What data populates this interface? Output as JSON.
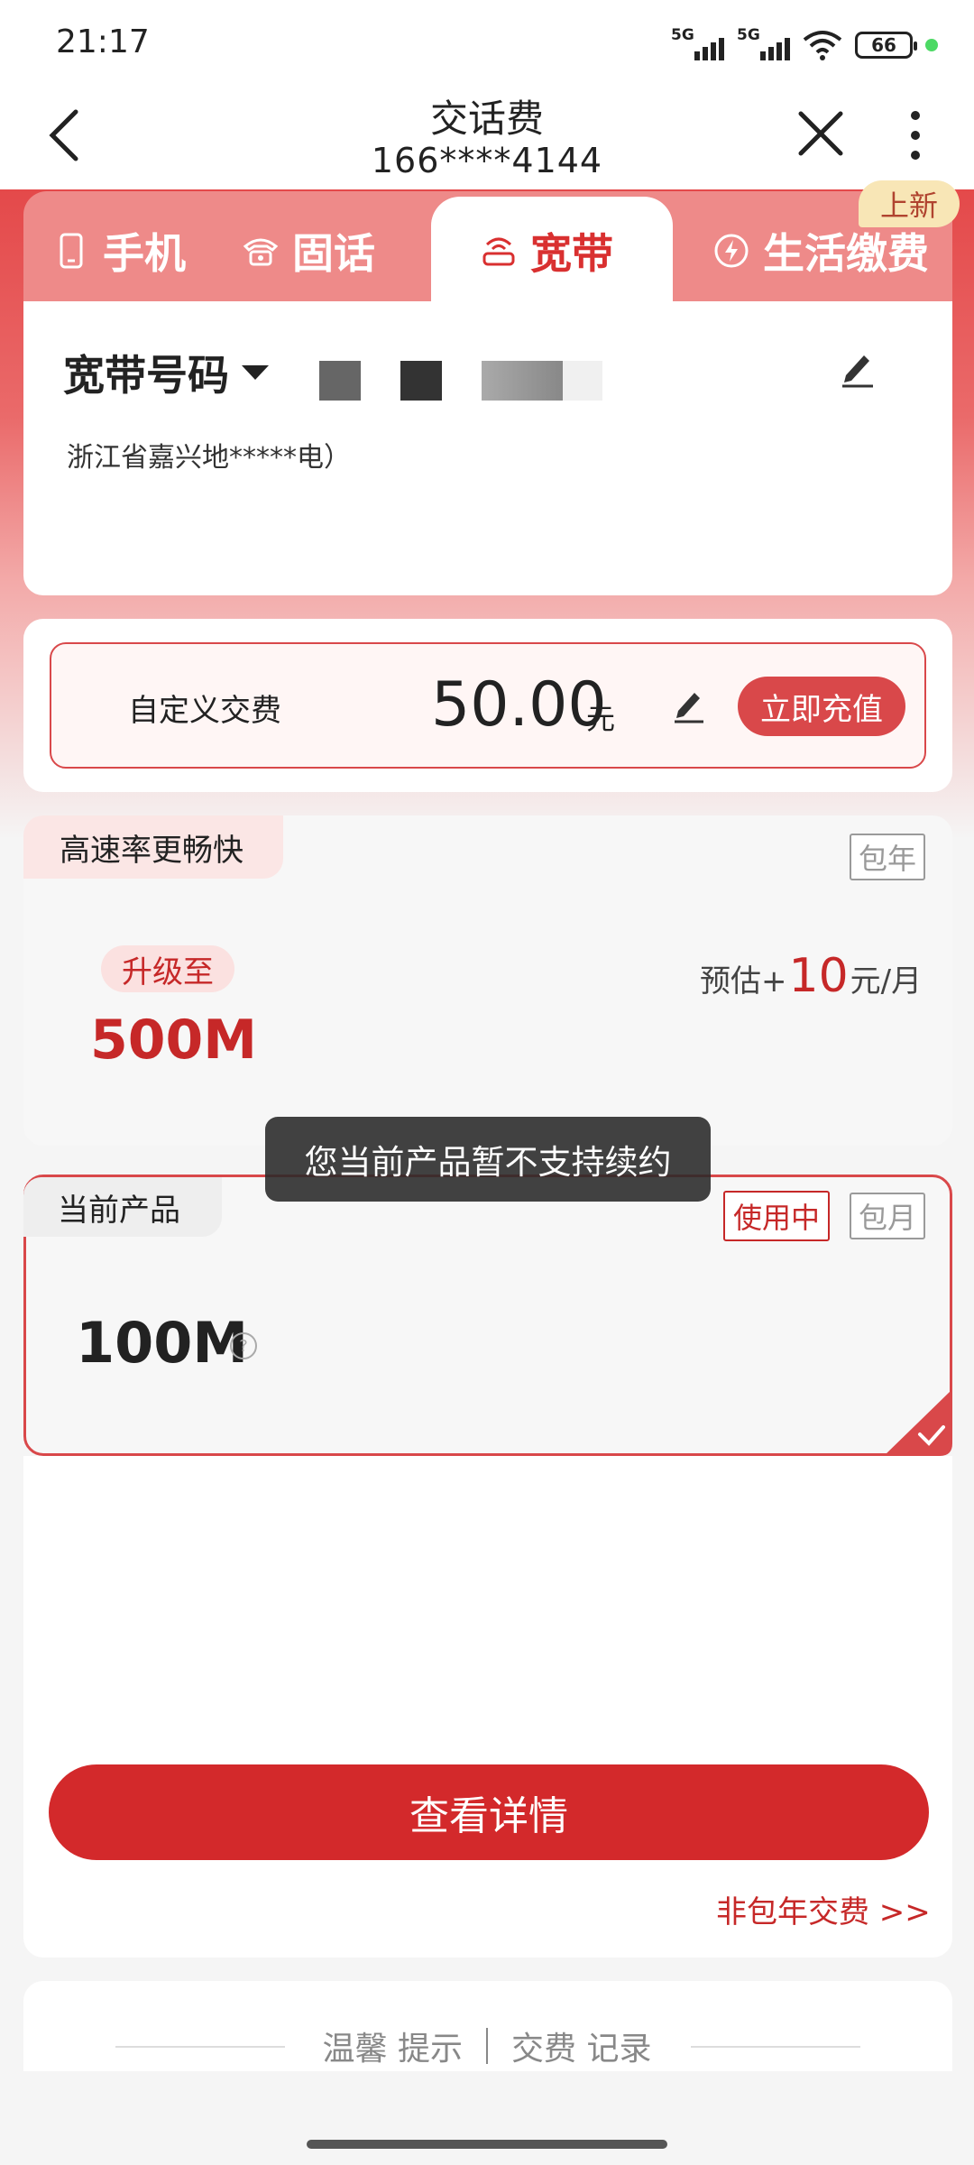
{
  "status_bar": {
    "time": "21:17",
    "signal1_label": "5G",
    "signal2_label": "5G",
    "battery": "66"
  },
  "nav": {
    "title": "交话费",
    "subtitle": "166****4144"
  },
  "tabs": [
    {
      "label": "手机",
      "icon": "phone-icon"
    },
    {
      "label": "固话",
      "icon": "landline-icon"
    },
    {
      "label": "宽带",
      "icon": "router-icon",
      "active": true
    },
    {
      "label": "生活缴费",
      "icon": "bolt-icon"
    }
  ],
  "new_badge": "上新",
  "account": {
    "label": "宽带号码",
    "address": "浙江省嘉兴地*****电）"
  },
  "custom_pay": {
    "label": "自定义交费",
    "amount": "50.00",
    "unit": "元",
    "button": "立即充值"
  },
  "upgrade": {
    "corner_tag": "高速率更畅快",
    "period_tag": "包年",
    "pill": "升级至",
    "speed": "500M",
    "price_prefix": "预估+",
    "price_value": "10",
    "price_unit": "元/月"
  },
  "toast": "您当前产品暂不支持续约",
  "current_product": {
    "corner_tag": "当前产品",
    "status_tag": "使用中",
    "period_tag": "包月",
    "speed": "100M"
  },
  "detail_button": "查看详情",
  "non_year_link": "非包年交费 >>",
  "footer": {
    "tips": "温馨 提示",
    "records": "交费 记录"
  },
  "colors": {
    "brand_red": "#d3292b",
    "accent_red": "#c62828",
    "badge_gold": "#f8e6b6"
  }
}
